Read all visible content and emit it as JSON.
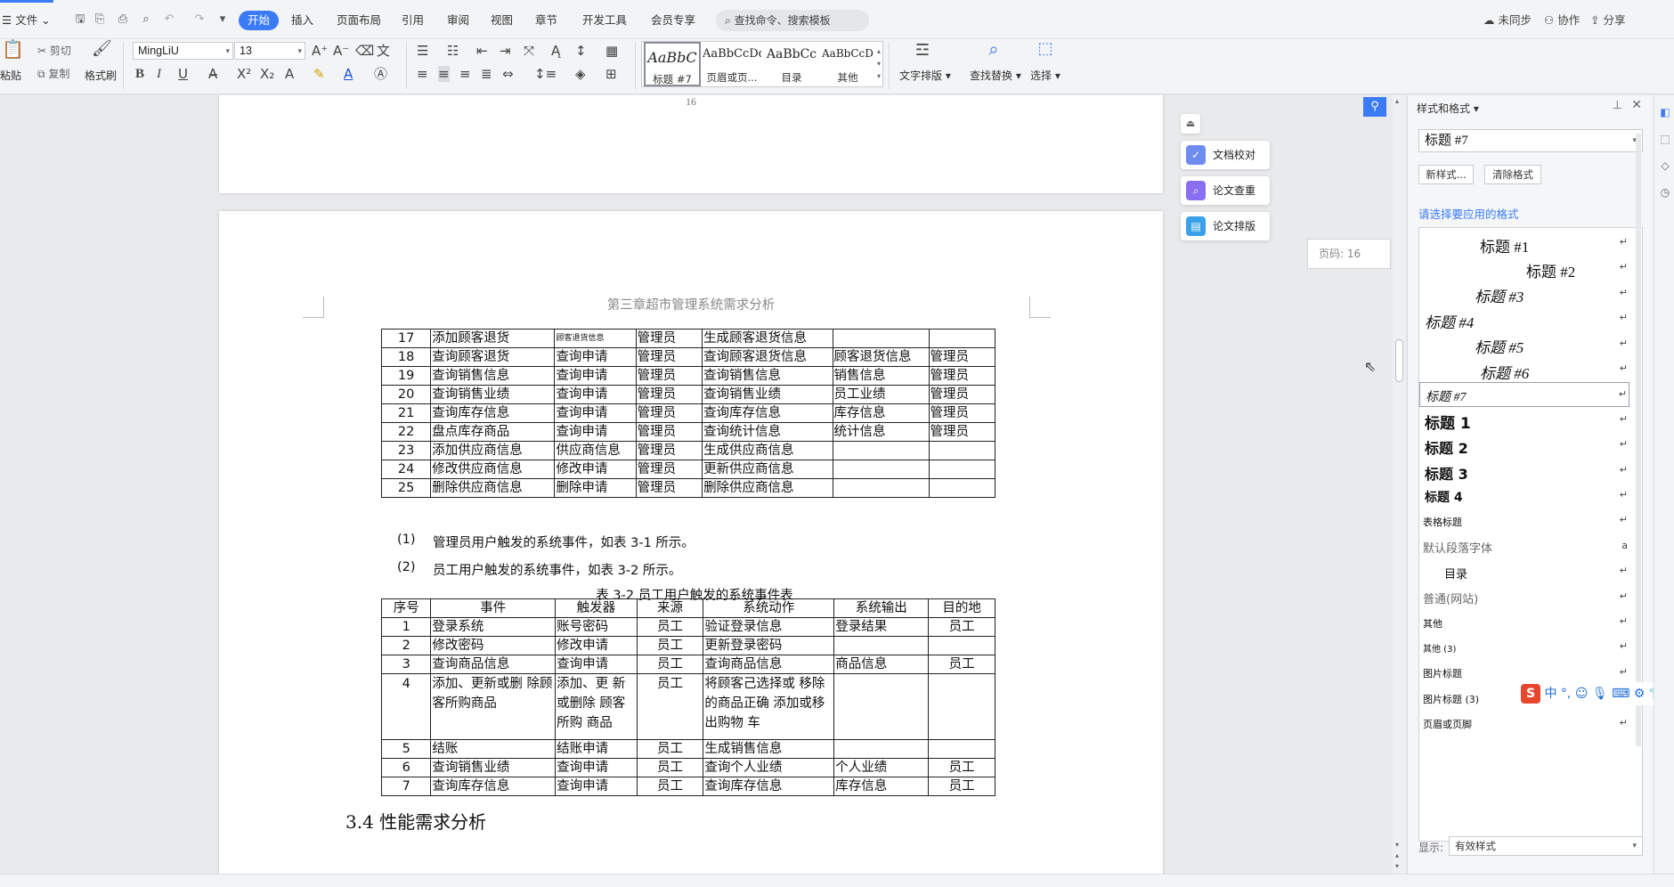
{
  "menubar": {
    "file": "文件",
    "tabs": [
      "开始",
      "插入",
      "页面布局",
      "引用",
      "审阅",
      "视图",
      "章节",
      "开发工具",
      "会员专享"
    ],
    "search_placeholder": "查找命令、搜索模板",
    "right": {
      "sync": "未同步",
      "collab": "协作",
      "share": "分享"
    }
  },
  "ribbon": {
    "paste": "粘贴",
    "cut": "剪切",
    "copy": "复制",
    "format_painter": "格式刷",
    "font_name": "MingLiU",
    "font_size": "13",
    "styles": [
      {
        "preview": "AaBbC",
        "label": "标题 #7"
      },
      {
        "preview": "AaBbCcDd",
        "label": "页眉或页..."
      },
      {
        "preview": "AaBbCc",
        "label": "目录"
      },
      {
        "preview": "AaBbCcDd",
        "label": "其他"
      }
    ],
    "text_layout": "文字排版",
    "find_replace": "查找替换",
    "select": "选择"
  },
  "document": {
    "prev_page_number": "16",
    "header": "第三章超市管理系统需求分析",
    "table1": [
      [
        "17",
        "添加顾客退货",
        "顾客退货信息",
        "管理员",
        "生成顾客退货信息",
        "",
        ""
      ],
      [
        "18",
        "查询顾客退货",
        "查询申请",
        "管理员",
        "查询顾客退货信息",
        "顾客退货信息",
        "管理员"
      ],
      [
        "19",
        "查询销售信息",
        "查询申请",
        "管理员",
        "查询销售信息",
        "销售信息",
        "管理员"
      ],
      [
        "20",
        "查询销售业绩",
        "查询申请",
        "管理员",
        "查询销售业绩",
        "员工业绩",
        "管理员"
      ],
      [
        "21",
        "查询库存信息",
        "查询申请",
        "管理员",
        "查询库存信息",
        "库存信息",
        "管理员"
      ],
      [
        "22",
        "盘点库存商品",
        "查询申请",
        "管理员",
        "查询统计信息",
        "统计信息",
        "管理员"
      ],
      [
        "23",
        "添加供应商信息",
        "供应商信息",
        "管理员",
        "生成供应商信息",
        "",
        ""
      ],
      [
        "24",
        "修改供应商信息",
        "修改申请",
        "管理员",
        "更新供应商信息",
        "",
        ""
      ],
      [
        "25",
        "删除供应商信息",
        "删除申请",
        "管理员",
        "删除供应商信息",
        "",
        ""
      ]
    ],
    "para1_num": "(1)",
    "para1": "管理员用户触发的系统事件，如表 3-1 所示。",
    "para2_num": "(2)",
    "para2": "员工用户触发的系统事件，如表 3-2 所示。",
    "caption2": "表 3-2 员工用户触发的系统事件表",
    "table2_headers": [
      "序号",
      "事件",
      "触发器",
      "来源",
      "系统动作",
      "系统输出",
      "目的地"
    ],
    "table2": [
      [
        "1",
        "登录系统",
        "账号密码",
        "员工",
        "验证登录信息",
        "登录结果",
        "员工"
      ],
      [
        "2",
        "修改密码",
        "修改申请",
        "员工",
        "更新登录密码",
        "",
        ""
      ],
      [
        "3",
        "查询商品信息",
        "查询申请",
        "员工",
        "查询商品信息",
        "商品信息",
        "员工"
      ],
      [
        "4",
        "添加、更新或删 除顾客所购商品",
        "添加、更 新或删除 顾客所购 商品",
        "员工",
        "将顾客己选择或 移除的商品正确 添加或移出购物 车",
        "",
        ""
      ],
      [
        "5",
        "结账",
        "结账申请",
        "员工",
        "生成销售信息",
        "",
        ""
      ],
      [
        "6",
        "查询销售业绩",
        "查询申请",
        "员工",
        "查询个人业绩",
        "个人业绩",
        "员工"
      ],
      [
        "7",
        "查询库存信息",
        "查询申请",
        "员工",
        "查询库存信息",
        "库存信息",
        "员工"
      ]
    ],
    "heading34": "3.4 性能需求分析"
  },
  "side_buttons": {
    "check": "文档校对",
    "dup": "论文查重",
    "layout": "论文排版"
  },
  "page_tip": "页码: 16",
  "panel": {
    "title": "样式和格式",
    "current_style": "标题 #7",
    "new_style": "新样式...",
    "clear_format": "清除格式",
    "hint": "请选择要应用的格式",
    "styles": [
      "标题 #1",
      "标题 #2",
      "标题 #3",
      "标题 #4",
      "标题 #5",
      "标题 #6",
      "标题 #7",
      "标题 1",
      "标题 2",
      "标题 3",
      "标题 4",
      "表格标题",
      "默认段落字体",
      "目录",
      "普通(网站)",
      "其他",
      "其他 (3)",
      "图片标题",
      "图片标题 (3)",
      "页眉或页脚"
    ],
    "show_label": "显示:",
    "show_value": "有效样式"
  },
  "ime": {
    "lang": "中"
  },
  "colors": {
    "accent": "#3b7bf6",
    "ime_red": "#e8472f"
  }
}
